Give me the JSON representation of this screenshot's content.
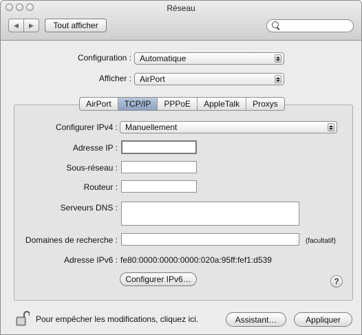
{
  "window": {
    "title": "Réseau"
  },
  "toolbar": {
    "show_all_label": "Tout afficher",
    "search_placeholder": ""
  },
  "location": {
    "configuration_label": "Configuration :",
    "configuration_value": "Automatique",
    "show_label": "Afficher :",
    "show_value": "AirPort"
  },
  "tabs": [
    {
      "label": "AirPort",
      "active": false
    },
    {
      "label": "TCP/IP",
      "active": true
    },
    {
      "label": "PPPoE",
      "active": false
    },
    {
      "label": "AppleTalk",
      "active": false
    },
    {
      "label": "Proxys",
      "active": false
    }
  ],
  "tcpip": {
    "configure_ipv4_label": "Configurer IPv4 :",
    "configure_ipv4_value": "Manuellement",
    "ip_label": "Adresse IP :",
    "ip_value": "",
    "subnet_label": "Sous-réseau :",
    "subnet_value": "",
    "router_label": "Routeur :",
    "router_value": "",
    "dns_label": "Serveurs DNS :",
    "dns_value": "",
    "search_domains_label": "Domaines de recherche :",
    "search_domains_value": "",
    "optional_label": "(facultatif)",
    "ipv6_label": "Adresse IPv6 :",
    "ipv6_value": "fe80:0000:0000:0000:020a:95ff:fef1:d539",
    "configure_ipv6_button": "Configurer IPv6…",
    "help_label": "?"
  },
  "footer": {
    "lock_text": "Pour empêcher les modifications, cliquez ici.",
    "assistant_button": "Assistant…",
    "apply_button": "Appliquer"
  }
}
